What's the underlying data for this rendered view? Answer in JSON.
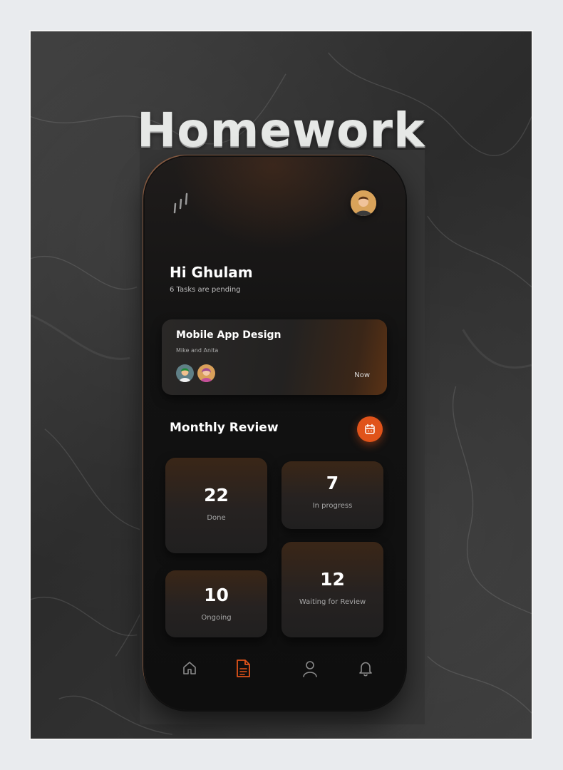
{
  "poster": {
    "title": "Homework"
  },
  "header": {
    "menu_icon": "bars-icon",
    "avatar_icon": "user-avatar"
  },
  "greeting": {
    "title": "Hi Ghulam",
    "subtitle": "6 Tasks are pending"
  },
  "task_card": {
    "title": "Mobile App Design",
    "people": "Mike and Anita",
    "time": "Now"
  },
  "monthly_review": {
    "title": "Monthly Review",
    "calendar_icon": "calendar-icon",
    "stats": [
      {
        "value": "22",
        "label": "Done"
      },
      {
        "value": "7",
        "label": "In progress"
      },
      {
        "value": "10",
        "label": "Ongoing"
      },
      {
        "value": "12",
        "label": "Waiting for Review"
      }
    ]
  },
  "bottom_nav": [
    {
      "icon": "home-icon",
      "active": false
    },
    {
      "icon": "document-icon",
      "active": true
    },
    {
      "icon": "profile-icon",
      "active": false
    },
    {
      "icon": "bell-icon",
      "active": false
    }
  ],
  "colors": {
    "accent": "#e0531a",
    "card": "#262221",
    "background": "#121212"
  }
}
